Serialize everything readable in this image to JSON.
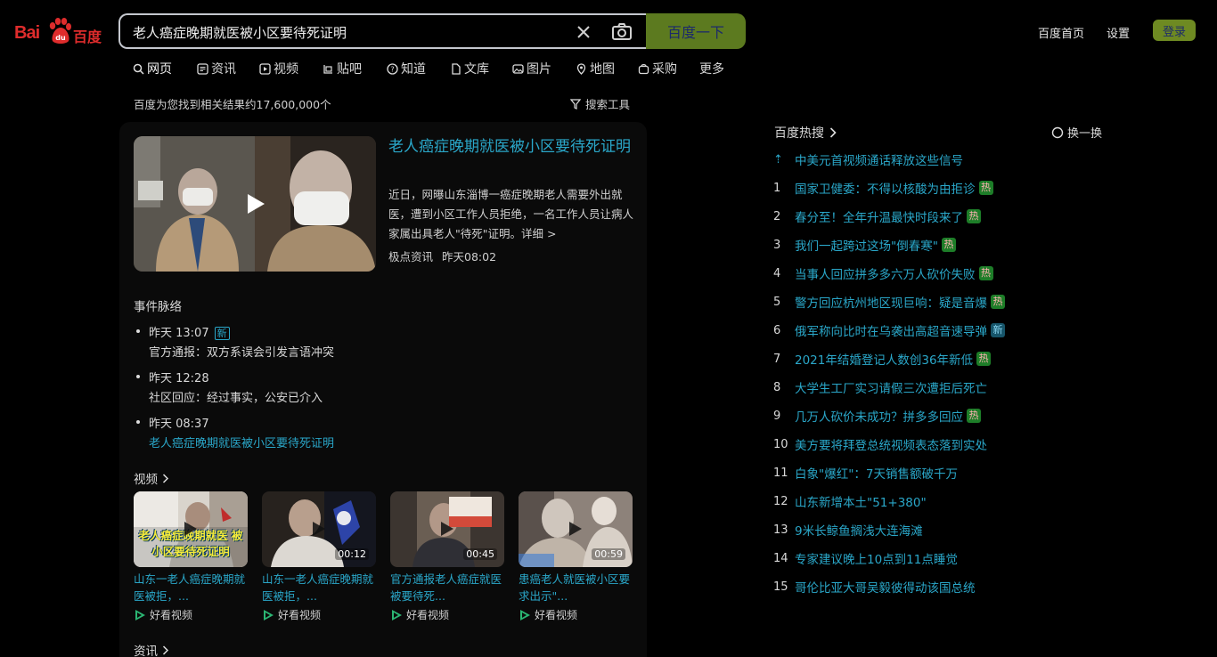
{
  "logo": {
    "text_bai": "Bai",
    "text_du": "百度",
    "paw_color": "#de2c2c"
  },
  "search": {
    "query": "老人癌症晚期就医被小区要待死证明",
    "button_label": "百度一下",
    "clear_icon": "close-icon",
    "camera_icon": "camera-icon"
  },
  "top_links": {
    "home": "百度首页",
    "settings": "设置",
    "login": "登录"
  },
  "tabs": [
    {
      "label": "网页",
      "icon": "search-icon"
    },
    {
      "label": "资讯",
      "icon": "news-icon"
    },
    {
      "label": "视频",
      "icon": "video-icon"
    },
    {
      "label": "贴吧",
      "icon": "tieba-icon"
    },
    {
      "label": "知道",
      "icon": "question-icon"
    },
    {
      "label": "文库",
      "icon": "doc-icon"
    },
    {
      "label": "图片",
      "icon": "image-icon"
    },
    {
      "label": "地图",
      "icon": "map-icon"
    },
    {
      "label": "采购",
      "icon": "cart-icon"
    },
    {
      "label": "更多",
      "icon": ""
    }
  ],
  "result_count": "百度为您找到相关结果约17,600,000个",
  "search_tools": "搜索工具",
  "news": {
    "title": "老人癌症晚期就医被小区要待死证明",
    "summary": "近日，网曝山东淄博一癌症晚期老人需要外出就医，遭到小区工作人员拒绝，一名工作人员让病人家属出具老人\"待死\"证明。",
    "more_link": "详细 >",
    "source": "极点资讯",
    "time": "昨天08:02"
  },
  "timeline": {
    "title": "事件脉络",
    "items": [
      {
        "time": "昨天 13:07",
        "badge": "新",
        "text": "官方通报：双方系误会引发言语冲突",
        "link": false
      },
      {
        "time": "昨天 12:28",
        "badge": "",
        "text": "社区回应：经过事实，公安已介入",
        "link": false
      },
      {
        "time": "昨天 08:37",
        "badge": "",
        "text": "老人癌症晚期就医被小区要待死证明",
        "link": true
      }
    ]
  },
  "videos": {
    "title": "视频",
    "items": [
      {
        "title": "山东一老人癌症晚期就医被拒，...",
        "duration": "",
        "overlay": "老人癌症晚期就医 被小区要待死证明",
        "source": "好看视频"
      },
      {
        "title": "山东一老人癌症晚期就医被拒，...",
        "duration": "00:12",
        "overlay": "",
        "source": "好看视频"
      },
      {
        "title": "官方通报老人癌症就医被要待死...",
        "duration": "00:45",
        "overlay": "",
        "source": "好看视频"
      },
      {
        "title": "患癌老人就医被小区要求出示\"...",
        "duration": "00:59",
        "overlay": "",
        "source": "好看视频"
      }
    ]
  },
  "news_section_title": "资讯",
  "hot": {
    "title": "百度热搜",
    "refresh": "换一换",
    "items": [
      {
        "rank": "⇡",
        "text": "中美元首视频通话释放这些信号",
        "tag": "",
        "top": true
      },
      {
        "rank": "1",
        "text": "国家卫健委：不得以核酸为由拒诊",
        "tag": "热"
      },
      {
        "rank": "2",
        "text": "春分至！全年升温最快时段来了",
        "tag": "热"
      },
      {
        "rank": "3",
        "text": "我们一起跨过这场\"倒春寒\"",
        "tag": "热"
      },
      {
        "rank": "4",
        "text": "当事人回应拼多多六万人砍价失败",
        "tag": "热"
      },
      {
        "rank": "5",
        "text": "警方回应杭州地区现巨响：疑是音爆",
        "tag": "热"
      },
      {
        "rank": "6",
        "text": "俄军称向比时在乌袭出高超音速导弹",
        "tag": "新"
      },
      {
        "rank": "7",
        "text": "2021年结婚登记人数创36年新低",
        "tag": "热"
      },
      {
        "rank": "8",
        "text": "大学生工厂实习请假三次遭拒后死亡",
        "tag": ""
      },
      {
        "rank": "9",
        "text": "几万人砍价未成功？拼多多回应",
        "tag": "热"
      },
      {
        "rank": "10",
        "text": "美方要将拜登总统视频表态落到实处",
        "tag": ""
      },
      {
        "rank": "11",
        "text": "白象\"爆红\"：7天销售额破千万",
        "tag": ""
      },
      {
        "rank": "12",
        "text": "山东新增本土\"51+380\"",
        "tag": ""
      },
      {
        "rank": "13",
        "text": "9米长鲸鱼搁浅大连海滩",
        "tag": ""
      },
      {
        "rank": "14",
        "text": "专家建议晚上10点到11点睡觉",
        "tag": ""
      },
      {
        "rank": "15",
        "text": "哥伦比亚大哥吴毅彼得动该国总统",
        "tag": ""
      }
    ]
  },
  "colors": {
    "link": "#2aa7c9",
    "brand_red": "#de2c2c",
    "button": "#5c7a1f",
    "hot_tag": "#1d7d28",
    "new_tag": "#17556a"
  }
}
